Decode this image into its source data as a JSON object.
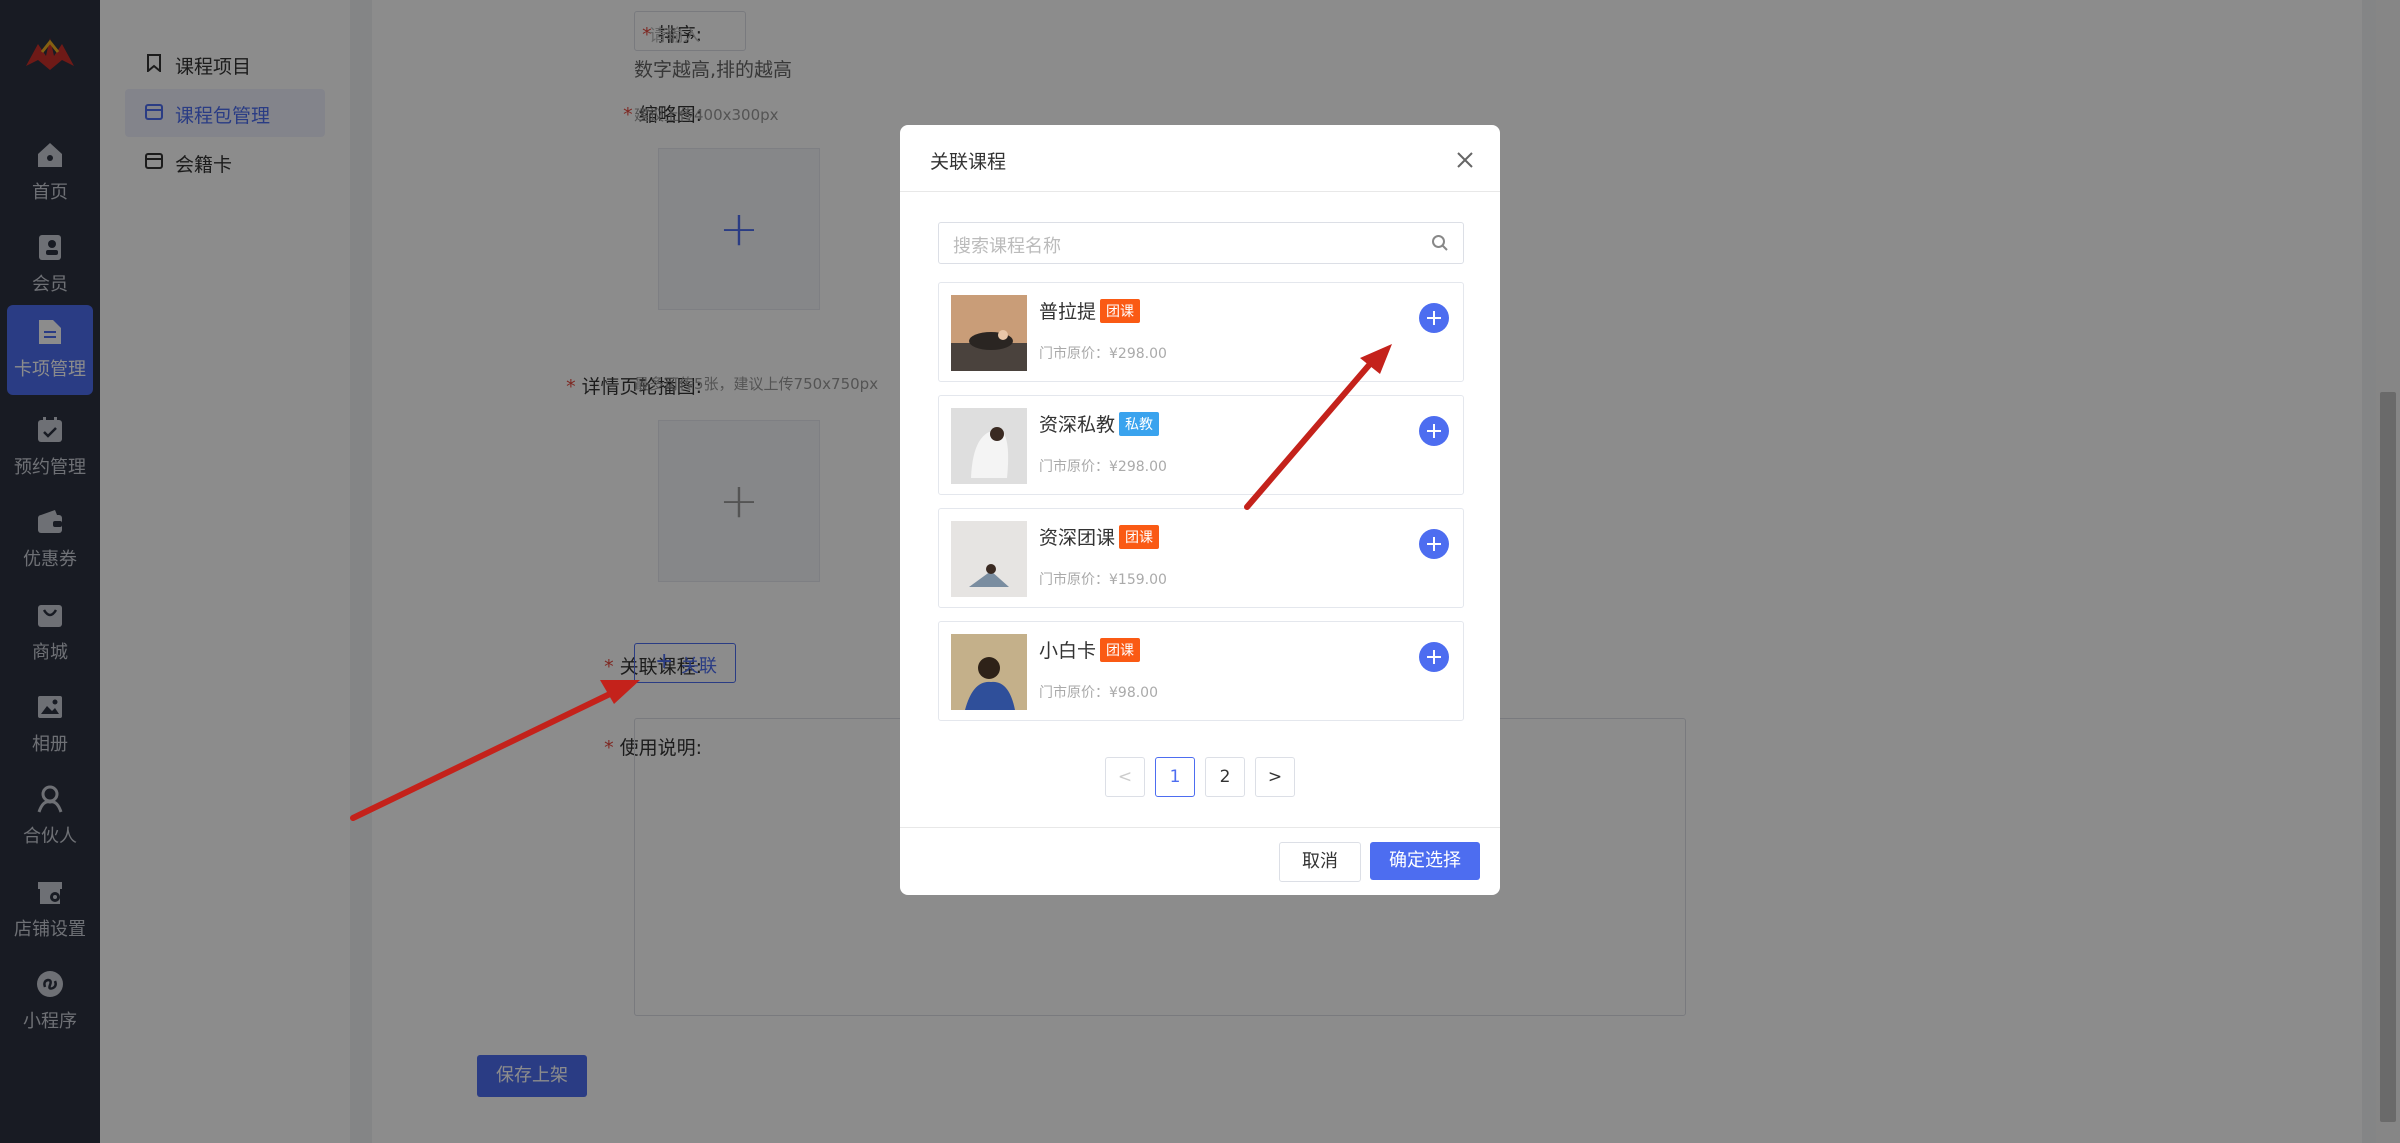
{
  "nav": {
    "items": [
      {
        "label": "首页",
        "icon": "home-icon"
      },
      {
        "label": "会员",
        "icon": "member-icon"
      },
      {
        "label": "卡项管理",
        "icon": "card-icon"
      },
      {
        "label": "预约管理",
        "icon": "calendar-icon"
      },
      {
        "label": "优惠券",
        "icon": "wallet-icon"
      },
      {
        "label": "商城",
        "icon": "shop-bag-icon"
      },
      {
        "label": "相册",
        "icon": "image-icon"
      },
      {
        "label": "合伙人",
        "icon": "partner-icon"
      },
      {
        "label": "店铺设置",
        "icon": "store-settings-icon"
      },
      {
        "label": "小程序",
        "icon": "miniprogram-icon"
      }
    ]
  },
  "submenu": {
    "items": [
      {
        "label": "课程项目",
        "icon": "bookmark-icon"
      },
      {
        "label": "课程包管理",
        "icon": "package-icon"
      },
      {
        "label": "会籍卡",
        "icon": "membership-card-icon"
      }
    ]
  },
  "form": {
    "sort_label": "排序:",
    "sort_placeholder": "请输入",
    "sort_hint": "数字越高,排的越高",
    "thumb_label": "缩略图:",
    "thumb_hint": "建议上传400x300px",
    "carousel_label": "详情页轮播图:",
    "carousel_hint": "最多可传5张，建议上传750x750px",
    "link_label": "关联课程:",
    "link_button": "关联",
    "usage_label": "使用说明:",
    "save_button": "保存上架"
  },
  "modal": {
    "title": "关联课程",
    "search_placeholder": "搜索课程名称",
    "courses": [
      {
        "name": "普拉提",
        "tag": "团课",
        "tag_color": "#fa5a14",
        "price": "门市原价：¥298.00"
      },
      {
        "name": "资深私教",
        "tag": "私教",
        "tag_color": "#3aa3ee",
        "price": "门市原价：¥298.00"
      },
      {
        "name": "资深团课",
        "tag": "团课",
        "tag_color": "#fa5a14",
        "price": "门市原价：¥159.00"
      },
      {
        "name": "小白卡",
        "tag": "团课",
        "tag_color": "#fa5a14",
        "price": "门市原价：¥98.00"
      }
    ],
    "pagination": {
      "prev": "<",
      "pages": [
        "1",
        "2"
      ],
      "current": "1",
      "next": ">"
    },
    "cancel": "取消",
    "confirm": "确定选择"
  },
  "colors": {
    "accent": "#4d6df0",
    "nav_bg": "#2d3240",
    "annotation_arrow": "#c4221b"
  }
}
